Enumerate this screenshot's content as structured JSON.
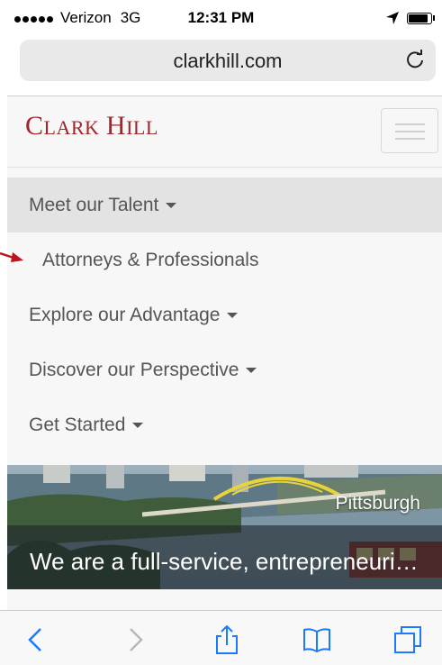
{
  "status_bar": {
    "carrier": "Verizon",
    "network": "3G",
    "time": "12:31 PM",
    "battery_level": 0.8
  },
  "browser": {
    "url": "clarkhill.com"
  },
  "site": {
    "logo": {
      "c": "C",
      "lark": "LARK",
      "h": "H",
      "ill": "ILL"
    },
    "nav": [
      {
        "label": "Meet our Talent",
        "has_caret": true,
        "active": true
      },
      {
        "label": "Attorneys & Professionals",
        "has_caret": false,
        "sub": true
      },
      {
        "label": "Explore our Advantage",
        "has_caret": true
      },
      {
        "label": "Discover our Perspective",
        "has_caret": true
      },
      {
        "label": "Get Started",
        "has_caret": true
      }
    ],
    "hero": {
      "city": "Pittsburgh",
      "tagline": "We are a full-service, entrepreneurial law firm"
    }
  },
  "colors": {
    "brand": "#a3242a",
    "toolbar_icon": "#1a7bff",
    "toolbar_disabled": "#b8b8b8"
  },
  "toolbar": {
    "icons": [
      "back-icon",
      "forward-icon",
      "share-icon",
      "bookmarks-icon",
      "tabs-icon"
    ]
  }
}
